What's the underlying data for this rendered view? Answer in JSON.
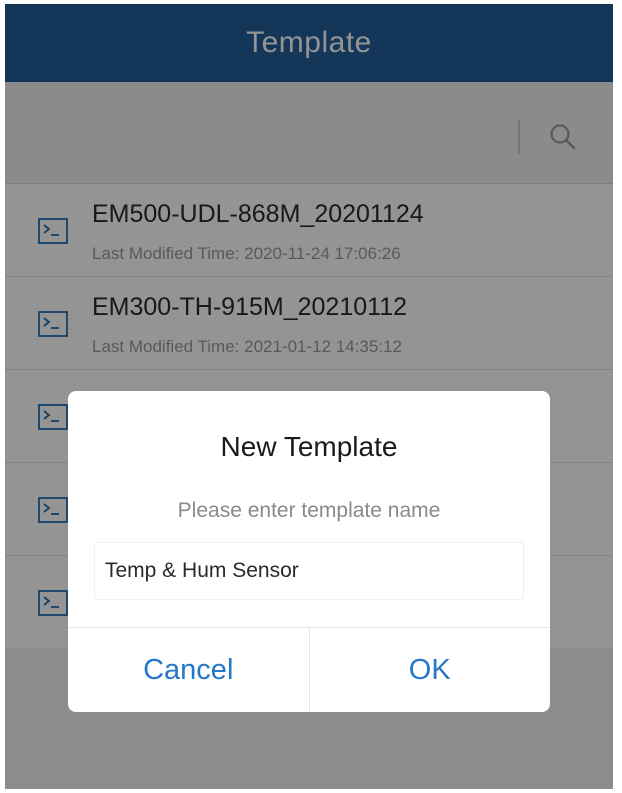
{
  "appbar": {
    "title": "Template"
  },
  "search": {
    "icon": "search-icon"
  },
  "templates": [
    {
      "name": "EM500-UDL-868M_20201124",
      "modified": "Last Modified Time: 2020-11-24 17:06:26",
      "icon": "terminal-icon"
    },
    {
      "name": "EM300-TH-915M_20210112",
      "modified": "Last Modified Time: 2021-01-12 14:35:12",
      "icon": "terminal-icon"
    },
    {
      "name": "",
      "modified": "",
      "icon": "terminal-icon"
    },
    {
      "name": "",
      "modified": "",
      "icon": "terminal-icon"
    },
    {
      "name": "",
      "modified": "",
      "icon": "terminal-icon"
    }
  ],
  "dialog": {
    "title": "New Template",
    "message": "Please enter template name",
    "input_value": "Temp & Hum Sensor",
    "cancel_label": "Cancel",
    "ok_label": "OK"
  },
  "colors": {
    "appbar": "#245f99",
    "accent": "#2578c7",
    "icon": "#1f6fb2"
  }
}
